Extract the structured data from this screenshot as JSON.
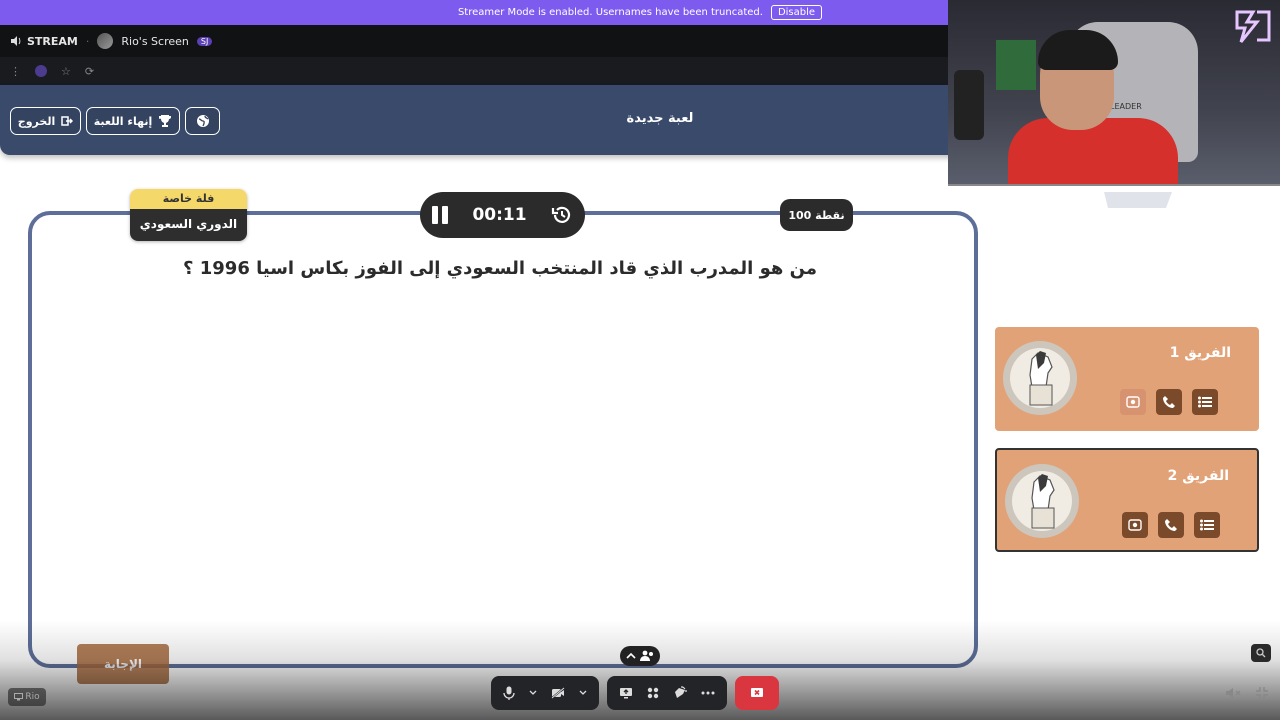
{
  "banner": {
    "message": "Streamer Mode is enabled. Usernames have been truncated.",
    "disable_label": "Disable"
  },
  "stream_bar": {
    "stream_label": "STREAM",
    "screen_label": "Rio's Screen",
    "badge_text": "SJ"
  },
  "header": {
    "title": "لعبة جديدة",
    "exit_label": "الخروج",
    "end_game_label": "إنهاء اللعبة"
  },
  "question_card": {
    "category_top": "فلة خاصة",
    "category_bottom": "الدوري السعودي",
    "timer": "00:11",
    "points": "100 نقطة",
    "question": "من هو المدرب الذي قاد المنتخب السعودي إلى الفوز بكاس اسيا 1996 ؟",
    "answer_label": "الإجابة"
  },
  "teams": [
    {
      "name": "الفريق 1"
    },
    {
      "name": "الفريق 2"
    }
  ],
  "viewer_tag": "Rio",
  "webcam": {
    "chair_brand": "LEADER"
  },
  "colors": {
    "banner": "#7e5bef",
    "header": "#3a4a6b",
    "card_border": "#5d6f99",
    "team_card": "#e2a277",
    "tool_button": "#7b4a2b",
    "answer_button": "#a86a3d",
    "end_call": "#d9363f"
  },
  "icons": [
    "globe-icon",
    "trophy-icon",
    "exit-icon",
    "pause-icon",
    "rewind-icon",
    "call-icon",
    "list-icon",
    "swap-icon",
    "mic-icon",
    "camera-off-icon",
    "screen-share-icon",
    "activities-icon",
    "soundboard-icon",
    "more-icon",
    "leave-call-icon"
  ]
}
